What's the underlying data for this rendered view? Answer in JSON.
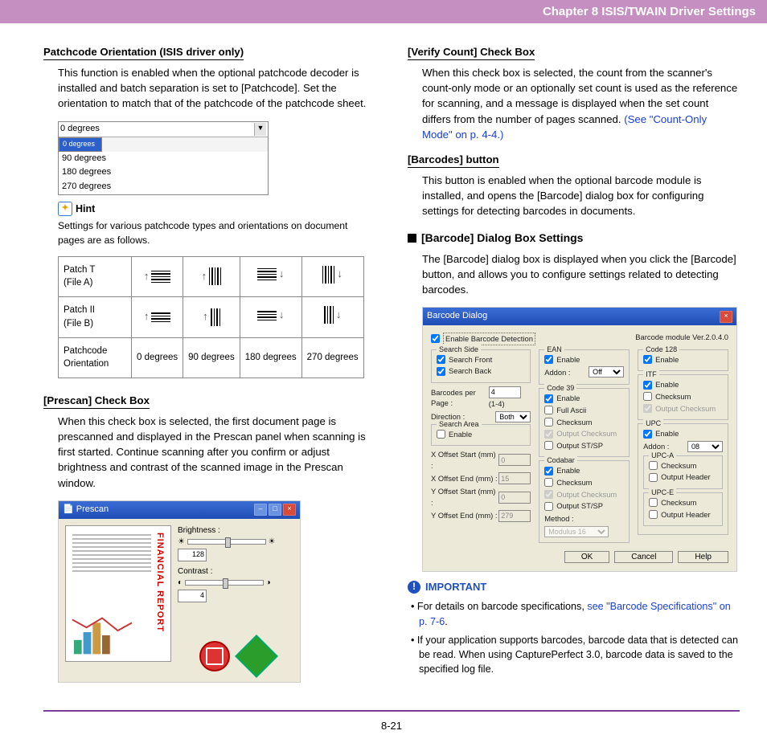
{
  "header": {
    "title": "Chapter 8   ISIS/TWAIN Driver Settings"
  },
  "left": {
    "h1": "Patchcode Orientation (ISIS driver only)",
    "p1": "This function is enabled when the optional patchcode decoder is installed and batch separation is set to [Patchcode]. Set the orientation to match that of the patchcode of the patchcode sheet.",
    "dropdown": {
      "top": "0 degrees",
      "items": [
        "0 degrees",
        "90 degrees",
        "180 degrees",
        "270 degrees"
      ]
    },
    "hint_label": "Hint",
    "hint_text": "Settings for various patchcode types and orientations on document pages are as follows.",
    "table": {
      "r1": "Patch T\n(File A)",
      "r2": "Patch II\n(File B)",
      "r3": "Patchcode\nOrientation",
      "c1": "0 degrees",
      "c2": "90 degrees",
      "c3": "180 degrees",
      "c4": "270 degrees"
    },
    "h2": " [Prescan] Check Box",
    "p2": "When this check box is selected, the first document page is prescanned and displayed in the Prescan panel when scanning is first started. Continue scanning after you confirm or adjust brightness and contrast of the scanned image in the Prescan window.",
    "prescan": {
      "title": "Prescan",
      "brightness": "Brightness :",
      "bval": "128",
      "contrast": "Contrast :",
      "cval": "4",
      "fin": "FINANCIAL REPORT"
    }
  },
  "right": {
    "h1": "[Verify Count] Check Box",
    "p1a": "When this check box is selected, the count from the scanner's count-only mode or an optionally set count is used as the reference for scanning, and a message is displayed when the set count differs from the number of pages scanned. ",
    "p1b": "(See \"Count-Only Mode\" on p. 4-4.)",
    "h2": "[Barcodes] button",
    "p2": "This button is enabled when the optional barcode module is installed, and opens the [Barcode] dialog box for configuring settings for detecting barcodes in documents.",
    "h3": "[Barcode] Dialog Box Settings",
    "p3": "The [Barcode] dialog box is displayed when you click the [Barcode] button, and allows you to configure settings related to detecting barcodes.",
    "barcode": {
      "title": "Barcode Dialog",
      "enable": "Enable Barcode Detection",
      "version": "Barcode module Ver.2.0.4.0",
      "search_side": "Search Side",
      "search_front": "Search Front",
      "search_back": "Search Back",
      "bpp": "Barcodes per Page :",
      "bpp_val": "4",
      "bpp_range": "(1-4)",
      "direction": "Direction :",
      "direction_val": "Both",
      "search_area": "Search Area",
      "sa_enable": "Enable",
      "xstart": "X Offset Start (mm) :",
      "xend": "X Offset End (mm) :",
      "ystart": "Y Offset Start (mm) :",
      "yend": "Y Offset End (mm) :",
      "xstart_v": "0",
      "xend_v": "15",
      "ystart_v": "0",
      "yend_v": "279",
      "ean": "EAN",
      "enable_lbl": "Enable",
      "addon": "Addon :",
      "addon_off": "Off",
      "code39": "Code 39",
      "fullascii": "Full Ascii",
      "checksum": "Checksum",
      "outstsp": "Output ST/SP",
      "codabar": "Codabar",
      "method": "Method :",
      "method_val": "Modulus 16",
      "code128": "Code 128",
      "itf": "ITF",
      "outchk": "Output Checksum",
      "upc": "UPC",
      "addon_08": "08",
      "upca": "UPC-A",
      "outhdr": "Output Header",
      "upce": "UPC-E",
      "ok": "OK",
      "cancel": "Cancel",
      "help": "Help"
    },
    "imp_label": "IMPORTANT",
    "b1a": "For details on barcode specifications, ",
    "b1b": "see \"Barcode Specifications\" on p. 7-6",
    "b1c": ".",
    "b2": "If your application supports barcodes, barcode data that is detected can be read. When using CapturePerfect 3.0, barcode data is saved to the specified log file."
  },
  "footer": {
    "page": "8-21"
  }
}
